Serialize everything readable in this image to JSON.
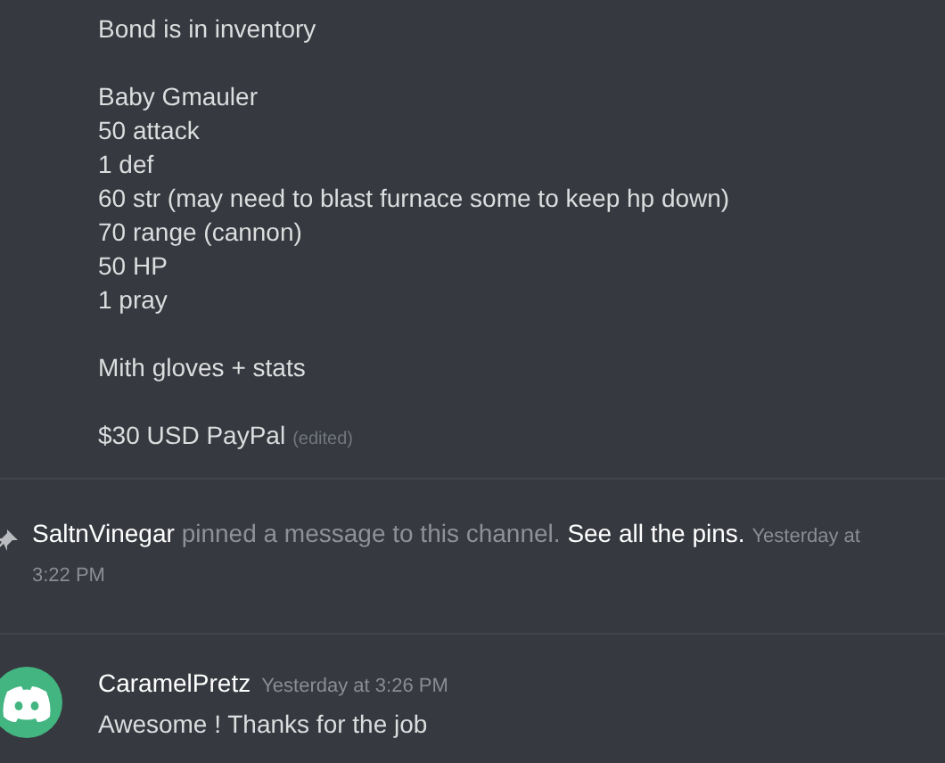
{
  "message": {
    "paragraphs": [
      [
        "Bond is in inventory"
      ],
      [
        "Baby Gmauler",
        "50 attack",
        "1 def",
        "60 str (may need to blast furnace some to keep hp down)",
        "70 range (cannon)",
        "50 HP",
        "1 pray"
      ],
      [
        "Mith gloves + stats"
      ],
      [
        "$30 USD PayPal"
      ]
    ],
    "edited": "(edited)"
  },
  "pin_notice": {
    "user": "SaltnVinegar",
    "text": "pinned a message to this channel.",
    "link": "See all the pins.",
    "timestamp_lines": [
      "Yesterday at",
      "3:22 PM"
    ]
  },
  "reply": {
    "author": "CaramelPretz",
    "timestamp": "Yesterday at 3:26 PM",
    "text": "Awesome ! Thanks for the job"
  }
}
